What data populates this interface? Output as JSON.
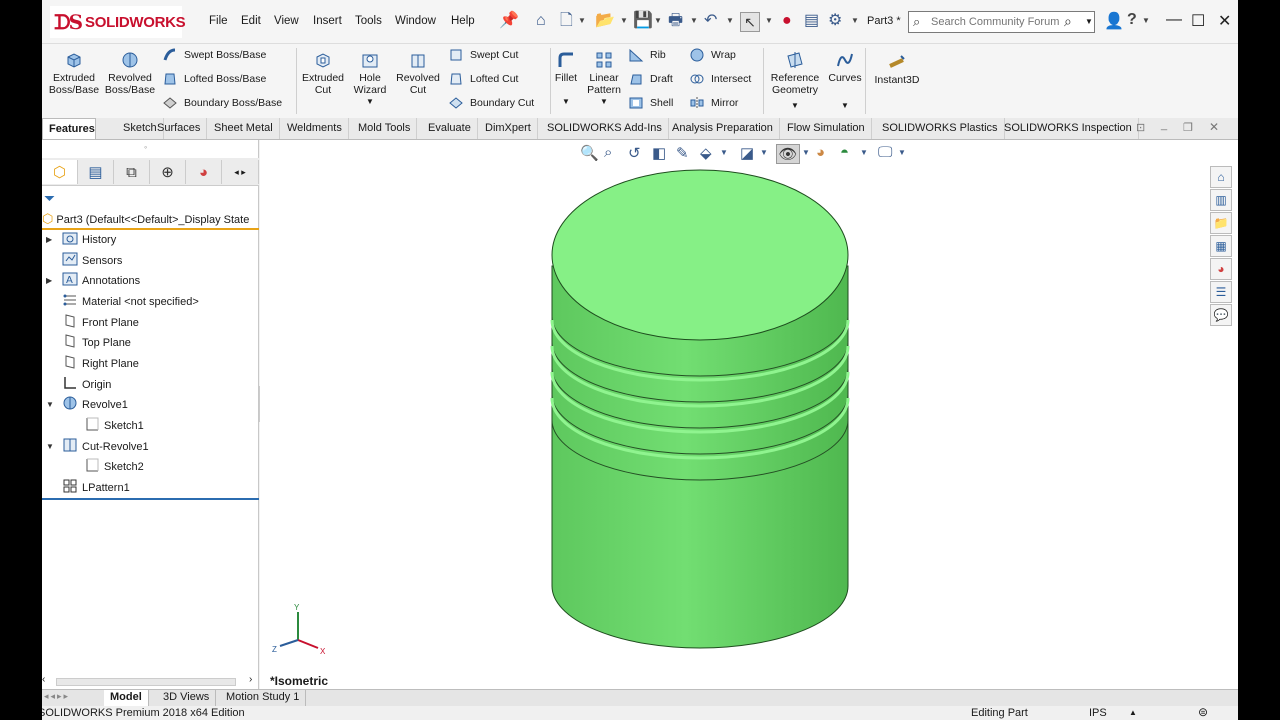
{
  "app": {
    "brand": "SOLIDWORKS",
    "brand_color": "#c8102e"
  },
  "menu": [
    "File",
    "Edit",
    "View",
    "Insert",
    "Tools",
    "Window",
    "Help"
  ],
  "doc_title": "Part3 *",
  "search": {
    "placeholder": "Search Community Forum"
  },
  "commands": {
    "extruded_boss": "Extruded\nBoss/Base",
    "revolved_boss": "Revolved\nBoss/Base",
    "swept_boss": "Swept Boss/Base",
    "lofted_boss": "Lofted Boss/Base",
    "boundary_boss": "Boundary Boss/Base",
    "extruded_cut": "Extruded\nCut",
    "hole_wizard": "Hole\nWizard",
    "revolved_cut": "Revolved\nCut",
    "swept_cut": "Swept Cut",
    "lofted_cut": "Lofted Cut",
    "boundary_cut": "Boundary Cut",
    "fillet": "Fillet",
    "linear_pattern": "Linear\nPattern",
    "rib": "Rib",
    "draft": "Draft",
    "shell": "Shell",
    "wrap": "Wrap",
    "intersect": "Intersect",
    "mirror": "Mirror",
    "reference_geometry": "Reference\nGeometry",
    "curves": "Curves",
    "instant3d": "Instant3D"
  },
  "tabs": [
    "Features",
    "Sketch",
    "Surfaces",
    "Sheet Metal",
    "Weldments",
    "Mold Tools",
    "Evaluate",
    "DimXpert",
    "SOLIDWORKS Add-Ins",
    "Analysis Preparation",
    "Flow Simulation",
    "SOLIDWORKS Plastics",
    "SOLIDWORKS Inspection"
  ],
  "tree": {
    "root": "Part3  (Default<<Default>_Display State",
    "items": [
      "History",
      "Sensors",
      "Annotations",
      "Material <not specified>",
      "Front Plane",
      "Top Plane",
      "Right Plane",
      "Origin",
      "Revolve1",
      "Sketch1",
      "Cut-Revolve1",
      "Sketch2",
      "LPattern1"
    ]
  },
  "viewport": {
    "view_name": "*Isometric",
    "model_color": "#6fdc6f",
    "top_face_color": "#86f086"
  },
  "triad": {
    "x": "X",
    "y": "Y",
    "z": "Z"
  },
  "model_tabs": [
    "Model",
    "3D Views",
    "Motion Study 1"
  ],
  "status": {
    "edition": "SOLIDWORKS Premium 2018 x64 Edition",
    "mode": "Editing Part",
    "units": "IPS"
  }
}
